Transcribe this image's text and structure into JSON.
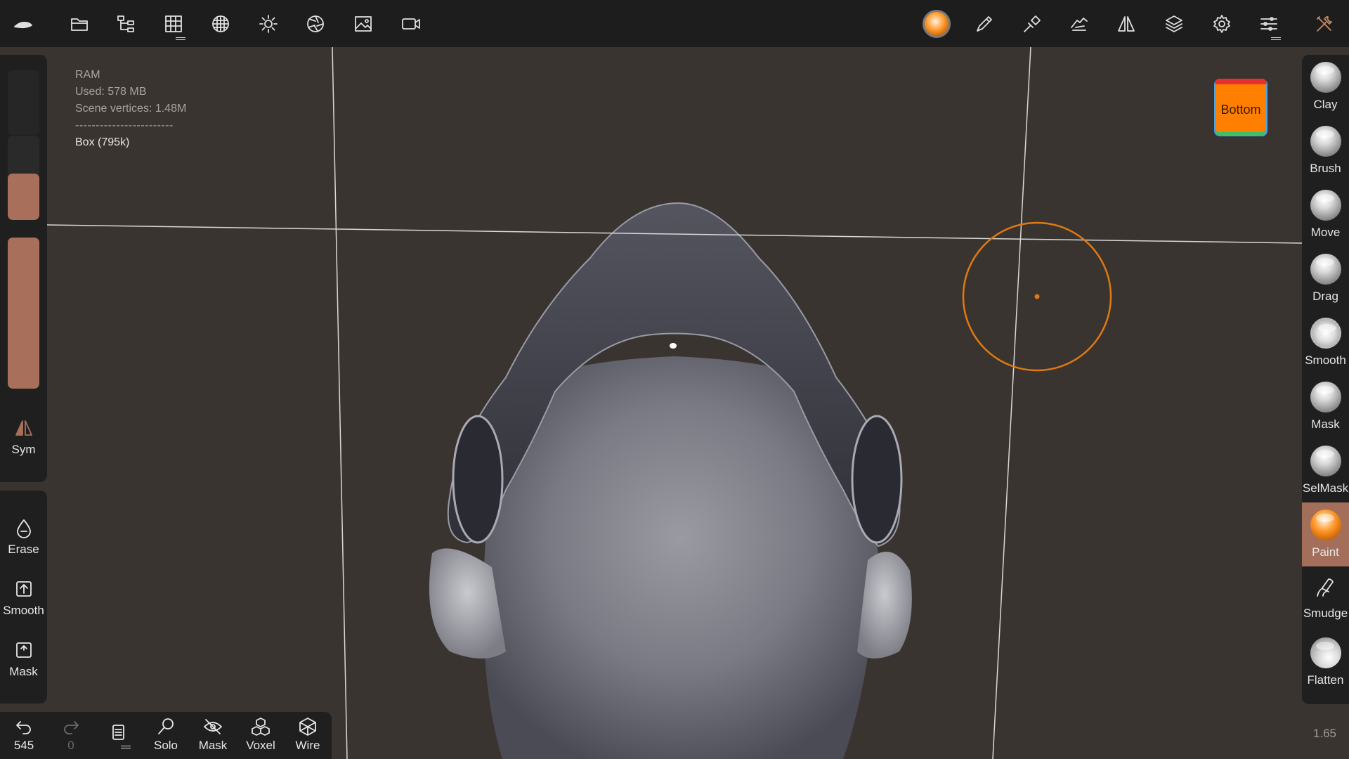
{
  "topbar": {
    "left_icons": [
      "app-logo-icon",
      "folder-icon",
      "scene-tree-icon",
      "topology-grid-icon",
      "material-sphere-icon",
      "light-sun-icon",
      "camera-aperture-icon",
      "background-image-icon",
      "video-camera-icon"
    ],
    "right_icons": [
      "paint-material-ball-icon",
      "stroke-brush-icon",
      "pen-tool-icon",
      "hand-gesture-icon",
      "symmetry-icon",
      "layers-icon",
      "settings-gear-icon",
      "sliders-menu-icon",
      "tools-wrench-icon"
    ]
  },
  "info": {
    "ram_label": "RAM",
    "used": "Used: 578 MB",
    "vertices": "Scene vertices: 1.48M",
    "separator": "------------------------",
    "object": "Box (795k)"
  },
  "view_cube": {
    "label": "Bottom",
    "face_color": "#ff7f00"
  },
  "left_panel": {
    "radius_slider_level": 0.55,
    "intensity_slider_level": 1.0,
    "sym_label": "Sym",
    "erase_label": "Erase",
    "smooth_label": "Smooth",
    "mask_label": "Mask"
  },
  "tools": [
    {
      "label": "Clay",
      "icon": "clay-ball-icon"
    },
    {
      "label": "Brush",
      "icon": "brush-ball-icon"
    },
    {
      "label": "Move",
      "icon": "move-ball-icon"
    },
    {
      "label": "Drag",
      "icon": "drag-ball-icon"
    },
    {
      "label": "Smooth",
      "icon": "smooth-ball-icon"
    },
    {
      "label": "Mask",
      "icon": "mask-ball-icon"
    },
    {
      "label": "SelMask",
      "icon": "selmask-ball-icon"
    },
    {
      "label": "Paint",
      "icon": "paint-ball-icon",
      "active": true
    },
    {
      "label": "Smudge",
      "icon": "smudge-icon"
    },
    {
      "label": "Flatten",
      "icon": "flatten-ball-icon"
    }
  ],
  "bottombar": {
    "undo_count": "545",
    "redo_count": "0",
    "solo_label": "Solo",
    "mask_label": "Mask",
    "voxel_label": "Voxel",
    "wire_label": "Wire"
  },
  "zoom_value": "1.65",
  "colors": {
    "accent": "#a8705a",
    "brush_cursor": "#e07a10",
    "background": "#3a3431"
  }
}
